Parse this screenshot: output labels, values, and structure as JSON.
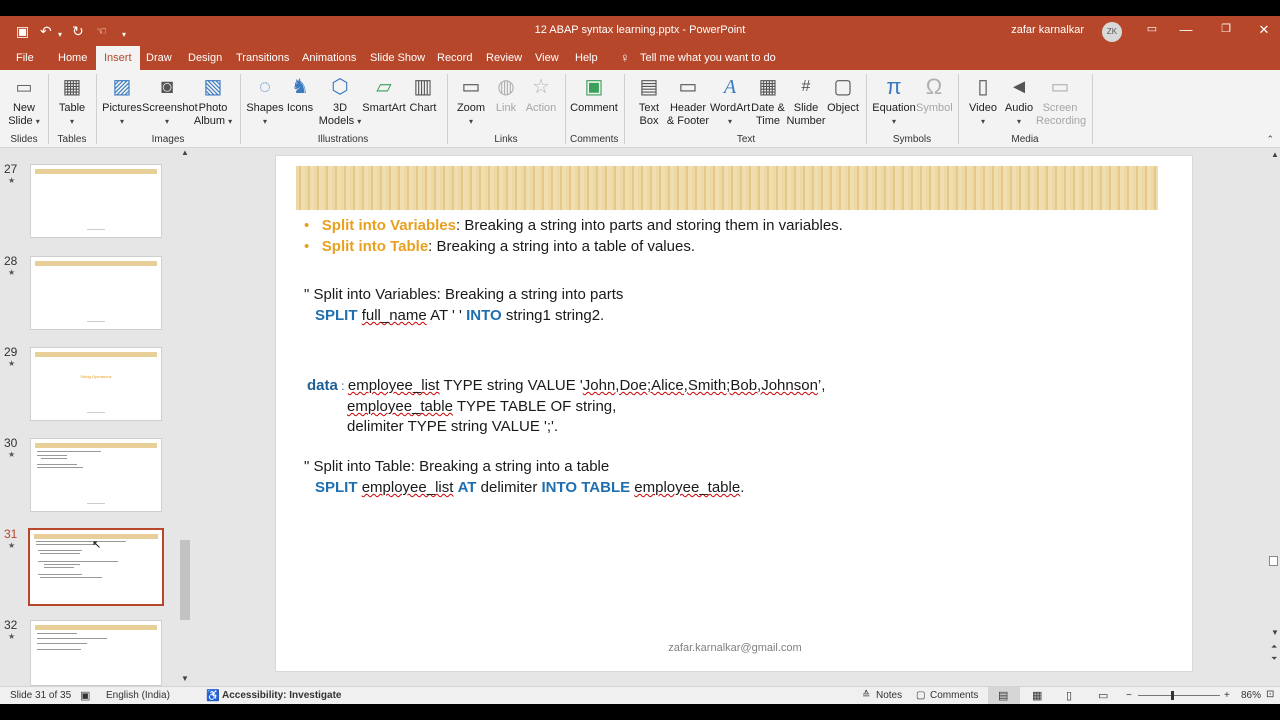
{
  "window": {
    "doc_title": "12 ABAP syntax learning.pptx  -  PowerPoint",
    "user_name": "zafar karnalkar",
    "avatar_initials": "ZK"
  },
  "tabs": [
    "File",
    "Home",
    "Insert",
    "Draw",
    "Design",
    "Transitions",
    "Animations",
    "Slide Show",
    "Record",
    "Review",
    "View",
    "Help"
  ],
  "tell_me": "Tell me what you want to do",
  "ribbon": {
    "new_slide_1": "New",
    "new_slide_2": "Slide",
    "table": "Table",
    "pictures": "Pictures",
    "screenshot": "Screenshot",
    "photo_album_1": "Photo",
    "photo_album_2": "Album",
    "shapes": "Shapes",
    "icons": "Icons",
    "models_1": "3D",
    "models_2": "Models",
    "smartart": "SmartArt",
    "chart": "Chart",
    "zoom": "Zoom",
    "link": "Link",
    "action": "Action",
    "comment": "Comment",
    "textbox_1": "Text",
    "textbox_2": "Box",
    "header_1": "Header",
    "header_2": "& Footer",
    "wordart": "WordArt",
    "datetime_1": "Date &",
    "datetime_2": "Time",
    "slidenum_1": "Slide",
    "slidenum_2": "Number",
    "object": "Object",
    "equation": "Equation",
    "symbol": "Symbol",
    "video": "Video",
    "audio": "Audio",
    "screenrec_1": "Screen",
    "screenrec_2": "Recording",
    "groups": {
      "slides": "Slides",
      "tables": "Tables",
      "images": "Images",
      "illustrations": "Illustrations",
      "links": "Links",
      "comments": "Comments",
      "text": "Text",
      "symbols": "Symbols",
      "media": "Media"
    }
  },
  "thumbnails": [
    {
      "num": "27",
      "thumb_title": ""
    },
    {
      "num": "28",
      "thumb_title": ""
    },
    {
      "num": "29",
      "thumb_title": "String Operations"
    },
    {
      "num": "30",
      "thumb_title": ""
    },
    {
      "num": "31",
      "thumb_title": ""
    },
    {
      "num": "32",
      "thumb_title": ""
    }
  ],
  "slide": {
    "bullet1_term": "Split into Variables",
    "bullet1_text": ": Breaking a string into parts and storing them in variables.",
    "bullet2_term": "Split into Table",
    "bullet2_text": ": Breaking a string into a table of values.",
    "comment1": "\" Split into Variables: Breaking a string into parts",
    "code1_kw": "SPLIT",
    "code1_var": "full_name",
    "code1_at": " AT ' ' ",
    "code1_into": "INTO",
    "code1_rest": " string1 string2.",
    "data_kw": "data",
    "data_colon": " : ",
    "decl1_var": "employee_list",
    "decl1_mid": " TYPE string VALUE '",
    "decl1_val": "John,Doe;Alice,Smith;Bob,Johnson",
    "decl1_end": "’,",
    "decl2_var": "employee_table",
    "decl2_rest": " TYPE TABLE OF string,",
    "decl3": "delimiter TYPE string VALUE ';'.",
    "comment2": "\" Split into Table: Breaking a string into a table",
    "code2_split": "SPLIT",
    "code2_var": "employee_list",
    "code2_at": "AT",
    "code2_delim": " delimiter ",
    "code2_into": "INTO TABLE",
    "code2_table": "employee_table",
    "code2_end": ".",
    "footer": "zafar.karnalkar@gmail.com"
  },
  "status": {
    "slide_count": "Slide 31 of 35",
    "language": "English (India)",
    "accessibility": "Accessibility: Investigate",
    "notes": "Notes",
    "comments": "Comments",
    "zoom": "86%"
  },
  "colors": {
    "accent": "#b7472a",
    "keyword": "#1f6fb0",
    "term": "#e8a020"
  }
}
